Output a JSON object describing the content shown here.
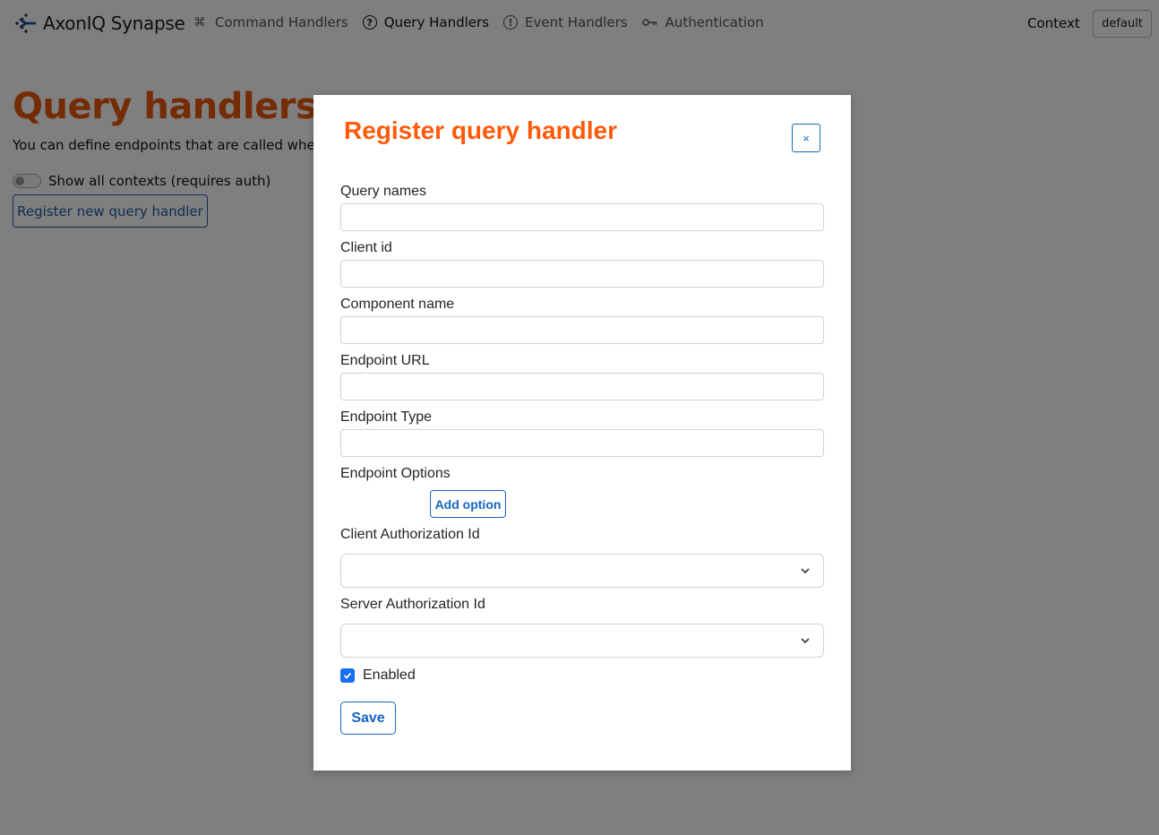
{
  "navbar": {
    "brand": "AxonIQ Synapse",
    "items": [
      {
        "label": "Command Handlers",
        "icon": "command-icon",
        "active": false
      },
      {
        "label": "Query Handlers",
        "icon": "question-circle-icon",
        "active": true
      },
      {
        "label": "Event Handlers",
        "icon": "exclamation-circle-icon",
        "active": false
      },
      {
        "label": "Authentication",
        "icon": "key-icon",
        "active": false
      }
    ],
    "context_label": "Context",
    "context_value": "default"
  },
  "page": {
    "title": "Query handlers",
    "description": "You can define endpoints that are called when a q",
    "toggle_label": "Show all contexts (requires auth)",
    "toggle_on": false,
    "register_button": "Register new query handler"
  },
  "modal": {
    "title": "Register query handler",
    "close_label": "×",
    "fields": {
      "query_names": {
        "label": "Query names",
        "value": ""
      },
      "client_id": {
        "label": "Client id",
        "value": ""
      },
      "component_name": {
        "label": "Component name",
        "value": ""
      },
      "endpoint_url": {
        "label": "Endpoint URL",
        "value": ""
      },
      "endpoint_type": {
        "label": "Endpoint Type",
        "value": ""
      },
      "endpoint_options": {
        "label": "Endpoint Options",
        "add_button": "Add option"
      },
      "client_authorization_id": {
        "label": "Client Authorization Id",
        "value": ""
      },
      "server_authorization_id": {
        "label": "Server Authorization Id",
        "value": ""
      },
      "enabled": {
        "label": "Enabled",
        "checked": true
      }
    },
    "save_button": "Save"
  },
  "colors": {
    "title_orange": "#e8590c",
    "modal_title_orange": "#ff5a0a",
    "primary_blue": "#1565c0",
    "checkbox_blue": "#1a6ef0"
  }
}
